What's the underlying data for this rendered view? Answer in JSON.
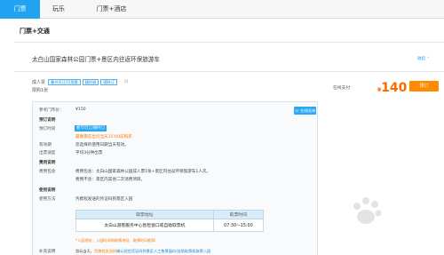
{
  "tabs": [
    {
      "label": "门票",
      "active": true
    },
    {
      "label": "玩乐",
      "active": false
    },
    {
      "label": "门票+酒店",
      "active": false
    }
  ],
  "section_title": "门票+交通",
  "product": {
    "name": "太白山国家森林公园门票+景区内往返环保旅游车",
    "collapse_label": "收起 ⌃"
  },
  "ticket": {
    "type_label": "成人票",
    "sub_label": "限购1张",
    "tags": [
      "春节可订/可用票",
      "随时退",
      "随时订"
    ],
    "tag_extra": "闪"
  },
  "price": {
    "label": "在线支付",
    "currency": "¥",
    "amount": "140",
    "book_label": "预订"
  },
  "details": {
    "online_chat": "在线咨询",
    "ref_price_label": "参考门市价：",
    "ref_price": "¥150",
    "sections": [
      {
        "label": "预订说明",
        "bold": true,
        "value": ""
      },
      {
        "label": "预订时间",
        "bold": false,
        "value": "",
        "highlight": "春节可订/随时订"
      },
      {
        "label": "",
        "bold": false,
        "value": "最晚需在出行当天15:00前购买",
        "color": "orange"
      },
      {
        "label": "有效期",
        "bold": false,
        "value": "您选择的使用日期当天有效。"
      },
      {
        "label": "出票速度",
        "bold": false,
        "value": "平均3分钟出票"
      },
      {
        "label": "费用说明",
        "bold": true,
        "value": ""
      },
      {
        "label": "费用包含",
        "bold": false,
        "value": "费用包含：太白山国家森林公园成人票1张+景区内往返环保旅游车1人次。"
      },
      {
        "label": "",
        "bold": false,
        "value": "费用不含：景区内其他二次消费项目。"
      },
      {
        "label": "使用说明",
        "bold": true,
        "value": ""
      },
      {
        "label": "使用方法",
        "bold": false,
        "value": "凭携程发送的凭证码到景区入园"
      }
    ],
    "table": {
      "headers": [
        "取票地址",
        "取票时间"
      ],
      "rows": [
        [
          "太白山游客服务中心售检窗口或自助取票机",
          "07:30～15:00"
        ]
      ]
    },
    "note": "*入园地址、入园时间和取票地址、取票时间相同",
    "bottom_label": "补充说明",
    "bottom_text_1": "游玩当天，",
    "bottom_text_2": "凭携程发送的",
    "bottom_text_3": "确认短信凭证码到景区人工售票窗口/自助取票机取票入园"
  },
  "colors": {
    "accent": "#20a3f0",
    "price": "#ff6600",
    "book_button": "#ff8a00"
  }
}
